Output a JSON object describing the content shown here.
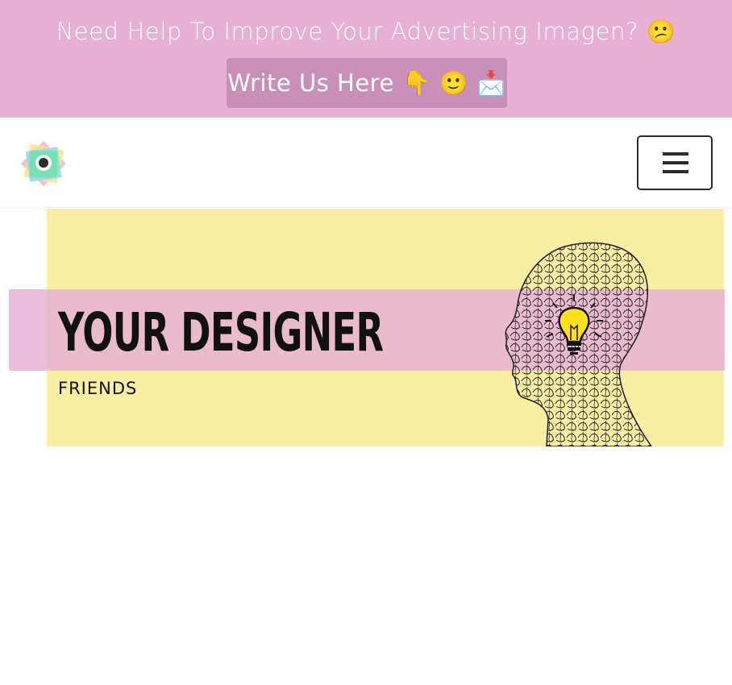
{
  "promo": {
    "text": "Need Help To Improve Your Advertising Imagen? 😕",
    "button_label": "Write Us Here 👇 🙂 📩"
  },
  "header": {
    "logo_icon": "camera-lens-logo-icon",
    "menu_icon": "hamburger-menu-icon"
  },
  "hero": {
    "title": "YOUR DESIGNER",
    "subtitle": "FRIENDS",
    "art_icon": "head-silhouette-lightbulb-icon",
    "background_color": "#f9eea1",
    "band_color": "#e6b2d4"
  },
  "colors": {
    "promo_bg": "#e6b1d3",
    "promo_button_bg": "#c890b9"
  }
}
